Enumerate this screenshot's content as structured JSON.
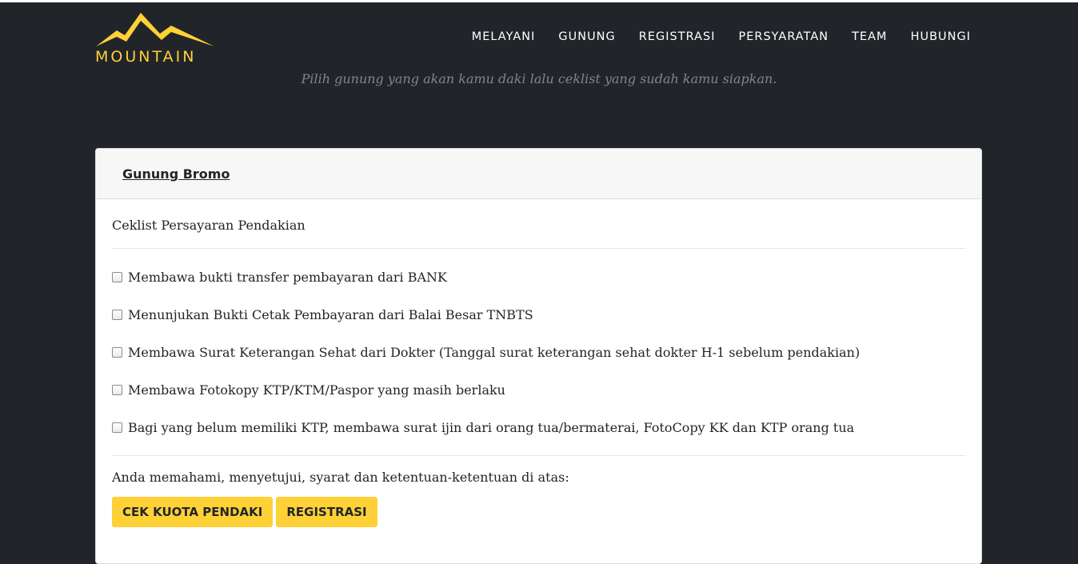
{
  "brand": {
    "name": "MOUNTAIN",
    "accent_color": "#fed136"
  },
  "nav": {
    "items": [
      "MELAYANI",
      "GUNUNG",
      "REGISTRASI",
      "PERSYARATAN",
      "TEAM",
      "HUBUNGI"
    ]
  },
  "page": {
    "subtitle": "Pilih gunung yang akan kamu daki lalu ceklist yang sudah kamu siapkan."
  },
  "card": {
    "title": "Gunung Bromo",
    "section_label": "Ceklist Persayaran Pendakian",
    "checklist": [
      {
        "label": "Membawa bukti transfer pembayaran dari BANK",
        "checked": false
      },
      {
        "label": "Menunjukan Bukti Cetak Pembayaran dari Balai Besar TNBTS",
        "checked": false
      },
      {
        "label": "Membawa Surat Keterangan Sehat dari Dokter (Tanggal surat keterangan sehat dokter H-1 sebelum pendakian)",
        "checked": false
      },
      {
        "label": "Membawa Fotokopy KTP/KTM/Paspor yang masih berlaku",
        "checked": false
      },
      {
        "label": "Bagi yang belum memiliki KTP, membawa surat ijin dari orang tua/bermaterai, FotoCopy KK dan KTP orang tua",
        "checked": false
      }
    ],
    "agreement_text": "Anda memahami, menyetujui, syarat dan ketentuan-ketentuan di atas:",
    "buttons": {
      "check_quota": "CEK KUOTA PENDAKI",
      "register": "REGISTRASI"
    }
  }
}
